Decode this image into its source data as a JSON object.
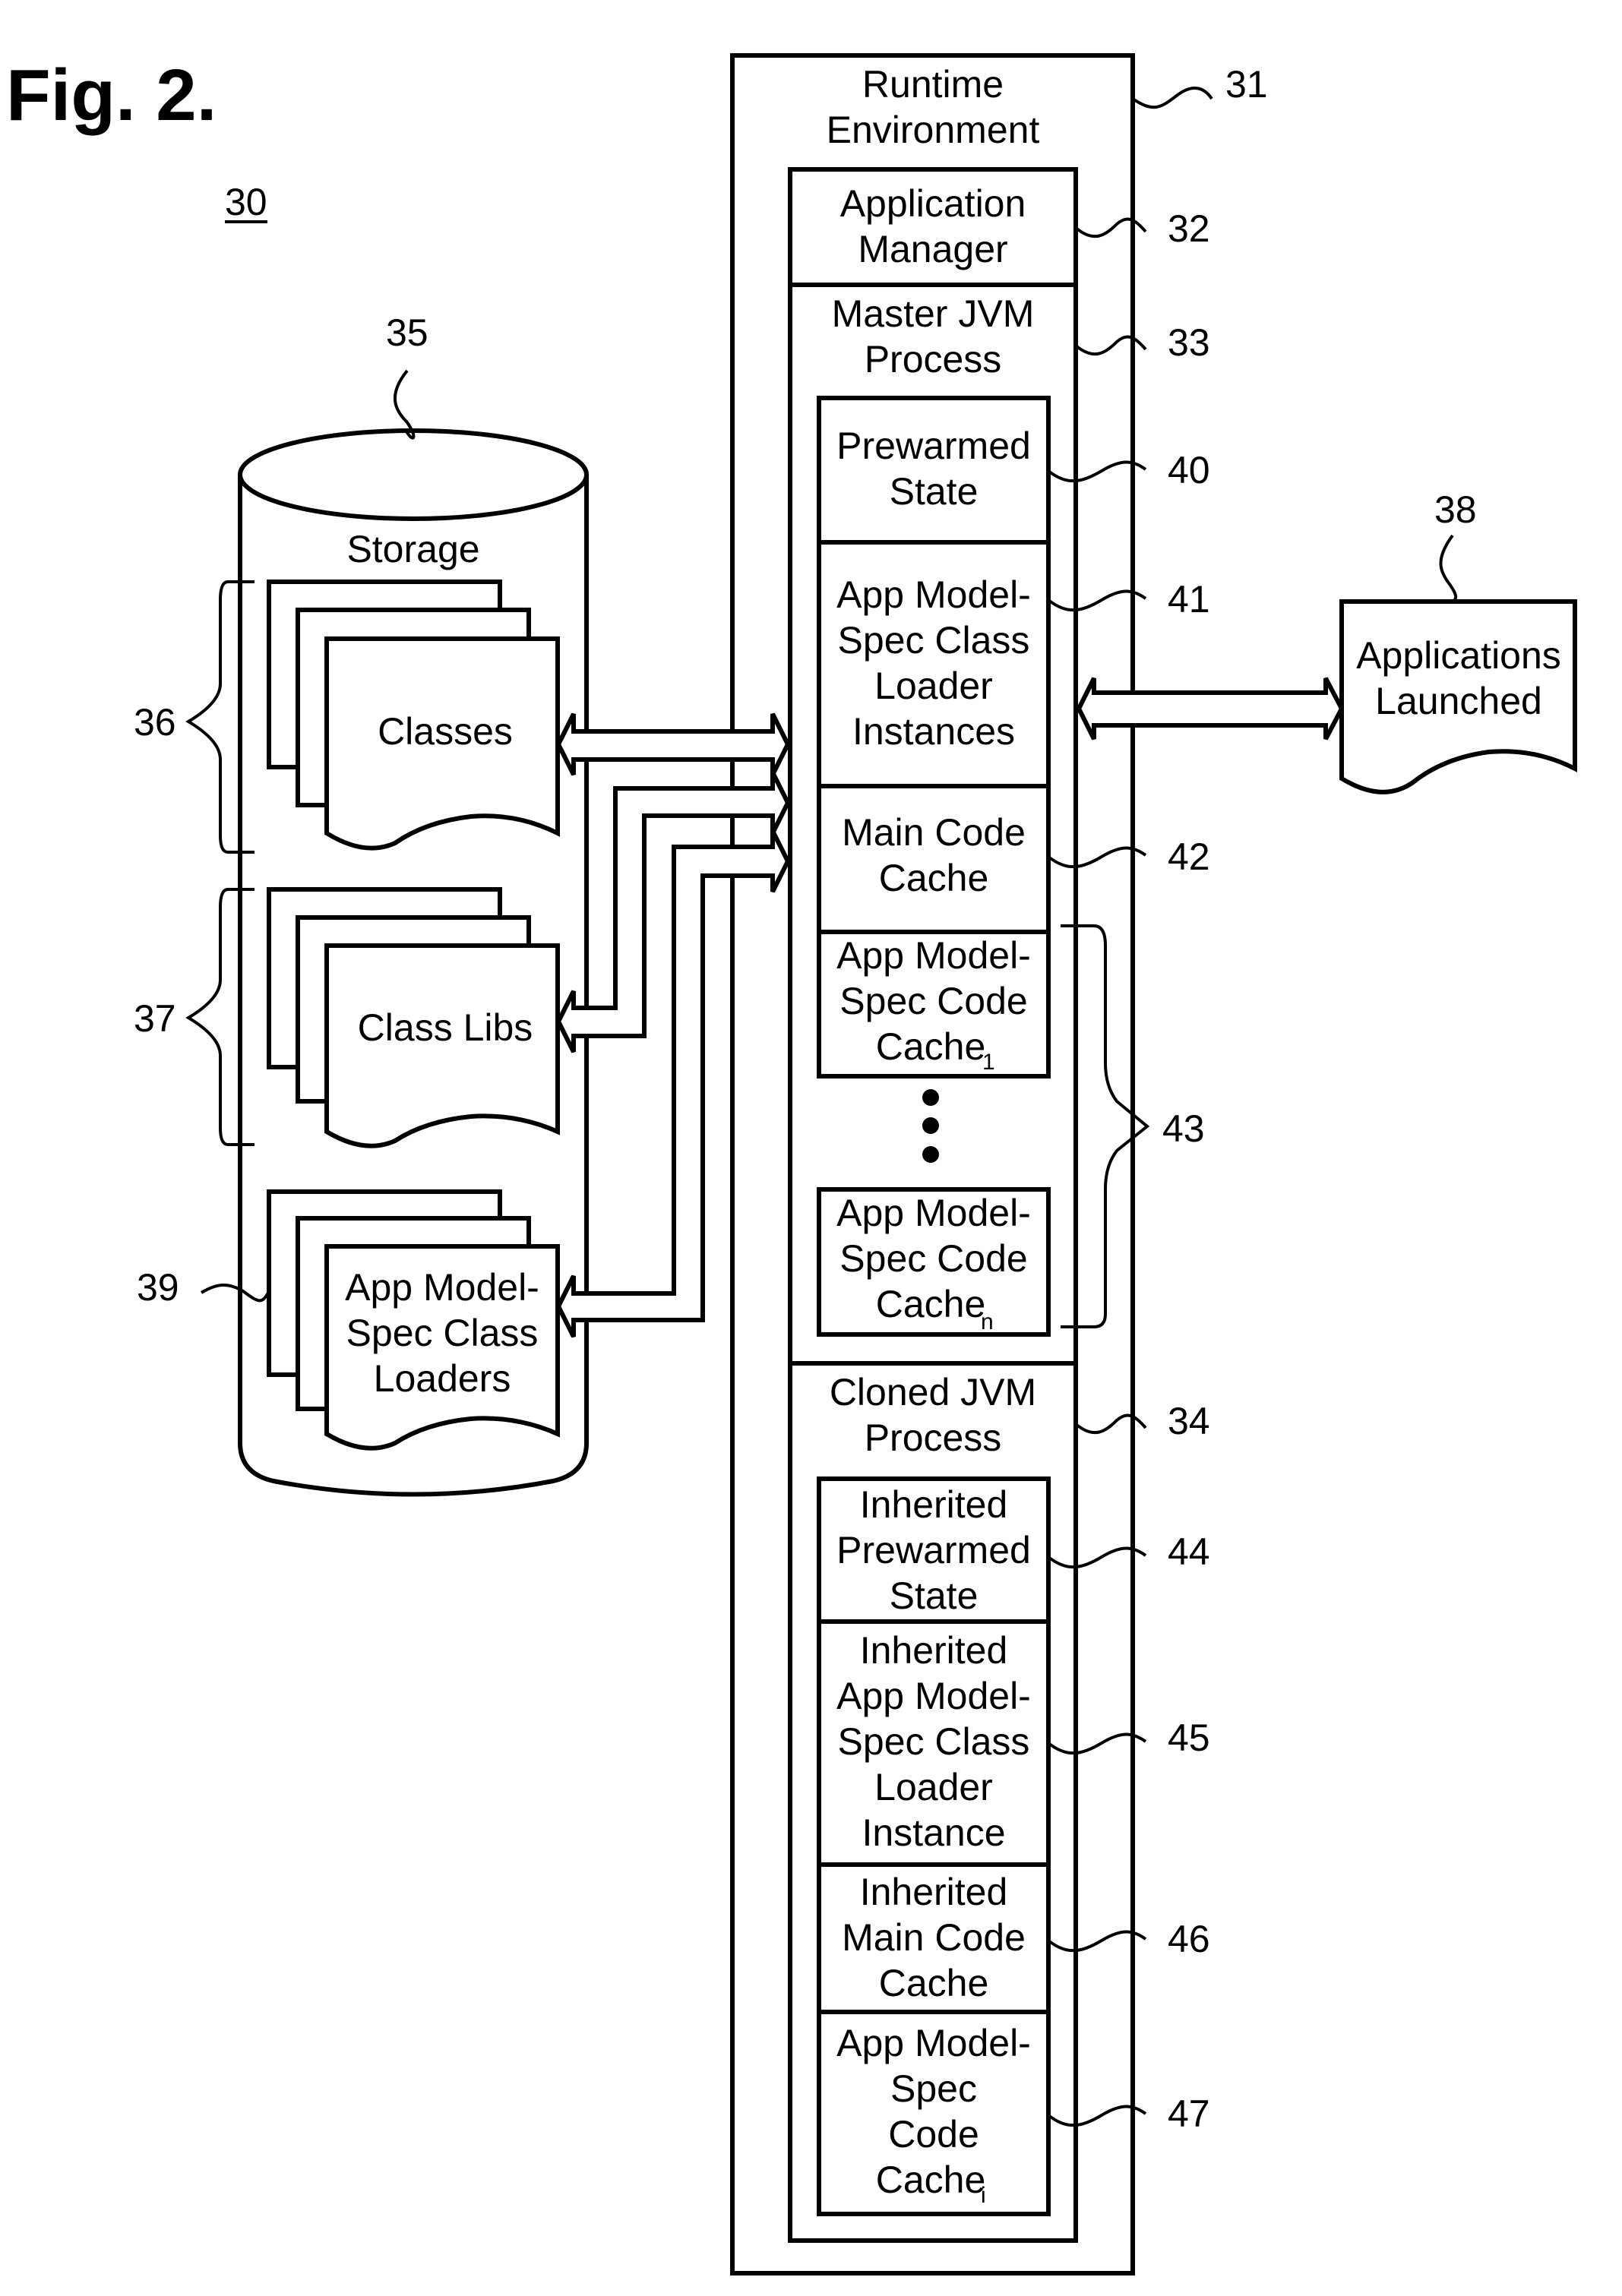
{
  "figure": {
    "title": "Fig. 2.",
    "reference": "30"
  },
  "storage": {
    "label": "Storage",
    "ref": "35",
    "groups": [
      {
        "ref": "36",
        "lines": [
          "Classes"
        ]
      },
      {
        "ref": "37",
        "lines": [
          "Class Libs"
        ]
      },
      {
        "ref": "39",
        "lines": [
          "App Model-",
          "Spec Class",
          "Loaders"
        ]
      }
    ]
  },
  "runtime": {
    "ref": "31",
    "lines": [
      "Runtime",
      "Environment"
    ],
    "application_manager": {
      "ref": "32",
      "lines": [
        "Application",
        "Manager"
      ]
    },
    "master_jvm": {
      "ref": "33",
      "lines": [
        "Master JVM",
        "Process"
      ],
      "components": [
        {
          "ref": "40",
          "lines": [
            "Prewarmed",
            "State"
          ]
        },
        {
          "ref": "41",
          "lines": [
            "App Model-",
            "Spec Class",
            "Loader",
            "Instances"
          ]
        },
        {
          "ref": "42",
          "lines": [
            "Main Code",
            "Cache"
          ]
        },
        {
          "lines": [
            "App Model-",
            "Spec Code",
            "Cache"
          ],
          "subscript": "1"
        },
        {
          "lines": [
            "App Model-",
            "Spec Code",
            "Cache"
          ],
          "subscript": "n"
        }
      ],
      "code_cache_group_ref": "43",
      "ellipsis": "vertical-dots"
    },
    "cloned_jvm": {
      "ref": "34",
      "lines": [
        "Cloned JVM",
        "Process"
      ],
      "components": [
        {
          "ref": "44",
          "lines": [
            "Inherited",
            "Prewarmed",
            "State"
          ]
        },
        {
          "ref": "45",
          "lines": [
            "Inherited",
            "App Model-",
            "Spec Class",
            "Loader",
            "Instance"
          ]
        },
        {
          "ref": "46",
          "lines": [
            "Inherited",
            "Main Code",
            "Cache"
          ]
        },
        {
          "ref": "47",
          "lines": [
            "App Model-",
            "Spec",
            "Code",
            "Cache"
          ],
          "subscript": "i"
        }
      ]
    }
  },
  "applications": {
    "ref": "38",
    "lines": [
      "Applications",
      "Launched"
    ]
  },
  "connections": [
    {
      "from": "Classes",
      "to": "Master JVM Process",
      "type": "bidirectional-arrow"
    },
    {
      "from": "Master JVM Process",
      "to": "Class Libs",
      "type": "arrow"
    },
    {
      "from": "Master JVM Process",
      "to": "App Model-Spec Class Loaders",
      "type": "arrow"
    },
    {
      "from": "Master JVM Process",
      "to": "Applications Launched",
      "type": "bidirectional-arrow"
    }
  ]
}
